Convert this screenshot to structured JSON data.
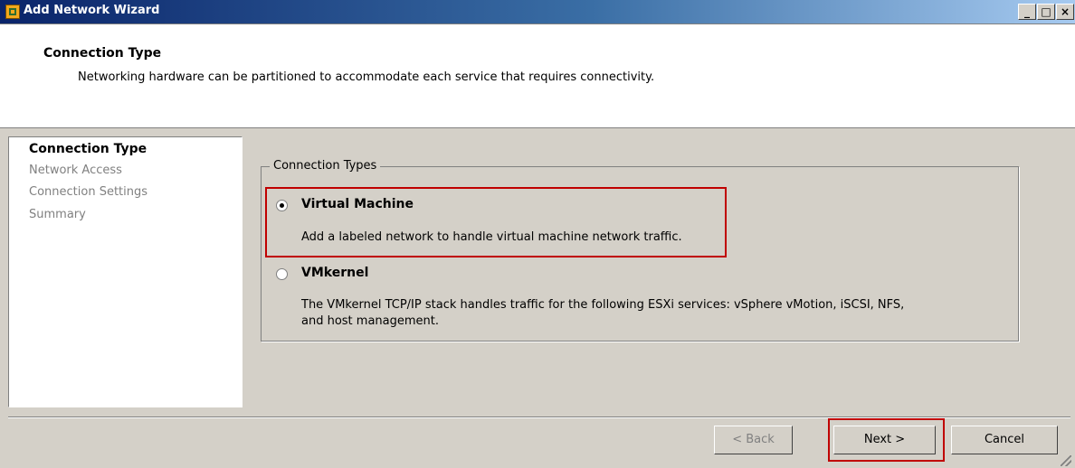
{
  "window": {
    "title": "Add Network Wizard",
    "minimize_label": "_",
    "maximize_label": "□",
    "close_label": "×"
  },
  "header": {
    "title": "Connection Type",
    "description": "Networking hardware can be partitioned to accommodate each service that requires connectivity."
  },
  "steps": [
    {
      "label": "Connection Type",
      "active": true
    },
    {
      "label": "Network Access",
      "active": false
    },
    {
      "label": "Connection Settings",
      "active": false
    },
    {
      "label": "Summary",
      "active": false
    }
  ],
  "connection_types": {
    "legend": "Connection Types",
    "options": [
      {
        "label": "Virtual Machine",
        "description": "Add a labeled network to handle virtual machine network traffic.",
        "selected": true
      },
      {
        "label": "VMkernel",
        "description_line1": "The VMkernel TCP/IP stack handles traffic for the following ESXi services: vSphere vMotion, iSCSI, NFS,",
        "description_line2": "and host management.",
        "selected": false
      }
    ]
  },
  "footer": {
    "back_label": "< Back",
    "back_enabled": false,
    "next_label": "Next >",
    "cancel_label": "Cancel"
  },
  "highlight_color": "#c00000"
}
